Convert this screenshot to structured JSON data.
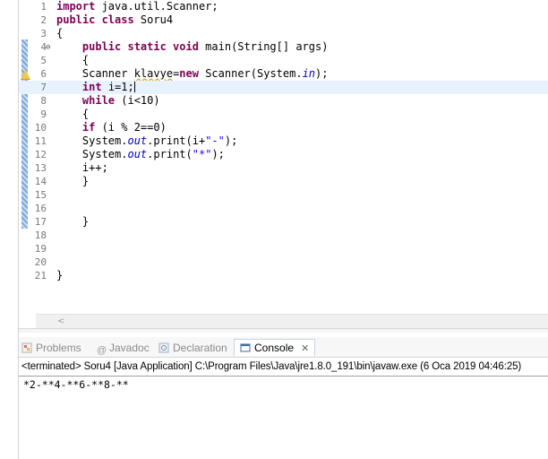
{
  "editor": {
    "lines": [
      {
        "n": "1",
        "html": "<span class=\"kw\">import</span> java.util.Scanner;"
      },
      {
        "n": "2",
        "html": "<span class=\"kw\">public class</span> Soru4"
      },
      {
        "n": "3",
        "html": "{"
      },
      {
        "n": "4",
        "html": "    <span class=\"kw\">public static void</span> main(String[] args)"
      },
      {
        "n": "5",
        "html": "    {"
      },
      {
        "n": "6",
        "html": "    Scanner <span class=\"warn\">klavye</span>=<span class=\"kw\">new</span> Scanner(System.<span class=\"fld\">in</span>);"
      },
      {
        "n": "7",
        "html": "    <span class=\"kw\">int</span> i=1;<span class=\"caret\"></span>"
      },
      {
        "n": "8",
        "html": "    <span class=\"kw\">while</span> (i&lt;10)"
      },
      {
        "n": "9",
        "html": "    {"
      },
      {
        "n": "10",
        "html": "    <span class=\"kw\">if</span> (i % 2==0)"
      },
      {
        "n": "11",
        "html": "    System.<span class=\"fld\">out</span>.print(i+<span class=\"str\">\"-\"</span>);"
      },
      {
        "n": "12",
        "html": "    System.<span class=\"fld\">out</span>.print(<span class=\"str\">\"*\"</span>);"
      },
      {
        "n": "13",
        "html": "    i++;"
      },
      {
        "n": "14",
        "html": "    }"
      },
      {
        "n": "15",
        "html": ""
      },
      {
        "n": "16",
        "html": ""
      },
      {
        "n": "17",
        "html": "    }"
      },
      {
        "n": "18",
        "html": ""
      },
      {
        "n": "19",
        "html": ""
      },
      {
        "n": "20",
        "html": ""
      },
      {
        "n": "21",
        "html": "}"
      }
    ],
    "current_line": "7",
    "fold_line": "4",
    "warning_line": "6"
  },
  "hscroll": {
    "left_arrow": "<"
  },
  "tabs": [
    {
      "label": "Problems",
      "icon": "problems-icon",
      "active": false
    },
    {
      "label": "Javadoc",
      "icon": "javadoc-icon",
      "active": false
    },
    {
      "label": "Declaration",
      "icon": "declaration-icon",
      "active": false
    },
    {
      "label": "Console",
      "icon": "console-icon",
      "active": true,
      "close": "✕"
    }
  ],
  "console": {
    "status": "<terminated> Soru4 [Java Application] C:\\Program Files\\Java\\jre1.8.0_191\\bin\\javaw.exe (6 Oca 2019 04:46:25)",
    "output": "*2-**4-**6-**8-**"
  },
  "colors": {
    "keyword": "#7f0055",
    "string": "#2a00ff",
    "field": "#0000c0",
    "current_line": "#e8f2fe"
  }
}
